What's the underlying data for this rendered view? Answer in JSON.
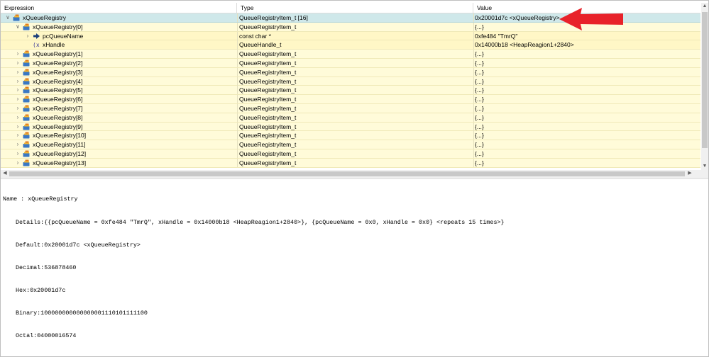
{
  "columns": {
    "expression": "Expression",
    "type": "Type",
    "value": "Value"
  },
  "rows": [
    {
      "expression": "xQueueRegistry",
      "type": "QueueRegistryItem_t [16]",
      "value": "0x20001d7c <xQueueRegistry>",
      "depth": 0,
      "chevron": "expanded",
      "icon": "array-variable-icon",
      "selected": true
    },
    {
      "expression": "xQueueRegistry[0]",
      "type": "QueueRegistryItem_t",
      "value": "{...}",
      "depth": 1,
      "chevron": "expanded",
      "icon": "struct-variable-icon"
    },
    {
      "expression": "pcQueueName",
      "type": "const char *",
      "value": "0xfe484 \"TmrQ\"",
      "depth": 2,
      "chevron": "collapsed",
      "icon": "pointer-arrow-icon"
    },
    {
      "expression": "xHandle",
      "type": "QueueHandle_t",
      "value": "0x14000b18 <HeapReagion1+2840>",
      "depth": 2,
      "chevron": "none",
      "icon": "variable-xy-icon"
    },
    {
      "expression": "xQueueRegistry[1]",
      "type": "QueueRegistryItem_t",
      "value": "{...}",
      "depth": 1,
      "chevron": "collapsed",
      "icon": "struct-variable-icon"
    },
    {
      "expression": "xQueueRegistry[2]",
      "type": "QueueRegistryItem_t",
      "value": "{...}",
      "depth": 1,
      "chevron": "collapsed",
      "icon": "struct-variable-icon"
    },
    {
      "expression": "xQueueRegistry[3]",
      "type": "QueueRegistryItem_t",
      "value": "{...}",
      "depth": 1,
      "chevron": "collapsed",
      "icon": "struct-variable-icon"
    },
    {
      "expression": "xQueueRegistry[4]",
      "type": "QueueRegistryItem_t",
      "value": "{...}",
      "depth": 1,
      "chevron": "collapsed",
      "icon": "struct-variable-icon"
    },
    {
      "expression": "xQueueRegistry[5]",
      "type": "QueueRegistryItem_t",
      "value": "{...}",
      "depth": 1,
      "chevron": "collapsed",
      "icon": "struct-variable-icon"
    },
    {
      "expression": "xQueueRegistry[6]",
      "type": "QueueRegistryItem_t",
      "value": "{...}",
      "depth": 1,
      "chevron": "collapsed",
      "icon": "struct-variable-icon"
    },
    {
      "expression": "xQueueRegistry[7]",
      "type": "QueueRegistryItem_t",
      "value": "{...}",
      "depth": 1,
      "chevron": "collapsed",
      "icon": "struct-variable-icon"
    },
    {
      "expression": "xQueueRegistry[8]",
      "type": "QueueRegistryItem_t",
      "value": "{...}",
      "depth": 1,
      "chevron": "collapsed",
      "icon": "struct-variable-icon"
    },
    {
      "expression": "xQueueRegistry[9]",
      "type": "QueueRegistryItem_t",
      "value": "{...}",
      "depth": 1,
      "chevron": "collapsed",
      "icon": "struct-variable-icon"
    },
    {
      "expression": "xQueueRegistry[10]",
      "type": "QueueRegistryItem_t",
      "value": "{...}",
      "depth": 1,
      "chevron": "collapsed",
      "icon": "struct-variable-icon"
    },
    {
      "expression": "xQueueRegistry[11]",
      "type": "QueueRegistryItem_t",
      "value": "{...}",
      "depth": 1,
      "chevron": "collapsed",
      "icon": "struct-variable-icon"
    },
    {
      "expression": "xQueueRegistry[12]",
      "type": "QueueRegistryItem_t",
      "value": "{...}",
      "depth": 1,
      "chevron": "collapsed",
      "icon": "struct-variable-icon"
    },
    {
      "expression": "xQueueRegistry[13]",
      "type": "QueueRegistryItem_t",
      "value": "{...}",
      "depth": 1,
      "chevron": "collapsed",
      "icon": "struct-variable-icon"
    }
  ],
  "details": {
    "name": "Name : xQueueRegistry",
    "details": "Details:{{pcQueueName = 0xfe484 \"TmrQ\", xHandle = 0x14000b18 <HeapReagion1+2840>}, {pcQueueName = 0x0, xHandle = 0x0} <repeats 15 times>}",
    "default": "Default:0x20001d7c <xQueueRegistry>",
    "decimal": "Decimal:536878460",
    "hex": "Hex:0x20001d7c",
    "binary": "Binary:100000000000000001110101111100",
    "octal": "Octal:04000016574"
  },
  "colors": {
    "row_background": "#fffbd9",
    "selected_row": "#cfe8ea",
    "annotation_arrow": "#e8222a"
  }
}
